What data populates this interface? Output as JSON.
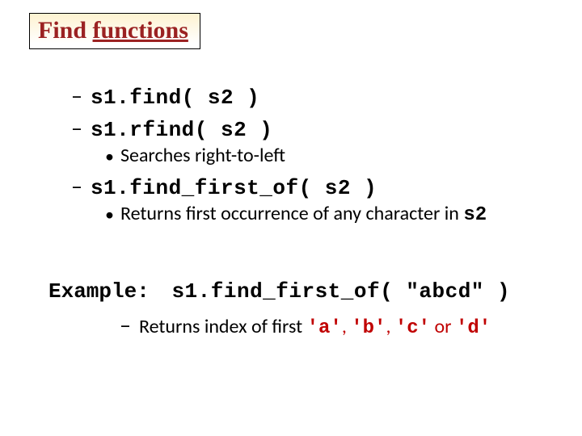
{
  "title": {
    "word1": "Find",
    "word2": "functions"
  },
  "items": {
    "find": "s1.find( s2 )",
    "rfind": "s1.rfind( s2 )",
    "rfind_note": "Searches right-to-left",
    "ffo": "s1.find_first_of( s2 )",
    "ffo_note_pre": "Returns first occurrence of any character in ",
    "ffo_note_code": "s2"
  },
  "example": {
    "label": "Example:",
    "code": "s1.find_first_of( \"abcd\" )",
    "sub_pre": "Returns index of first ",
    "c1": "'a'",
    "s1": ", ",
    "c2": "'b'",
    "s2": ", ",
    "c3": "'c'",
    "s3": " or ",
    "c4": "'d'"
  }
}
